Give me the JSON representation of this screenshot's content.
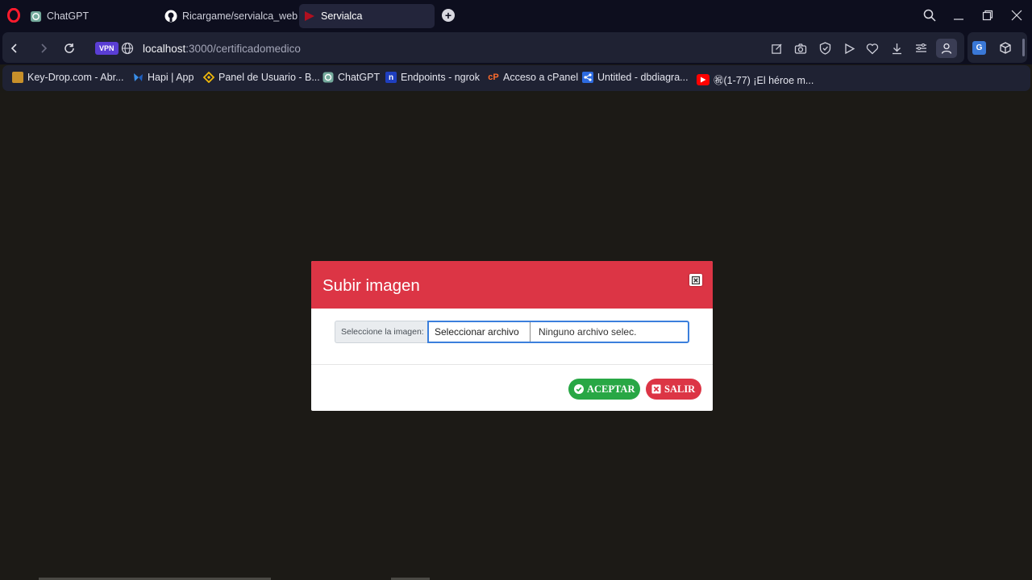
{
  "browser": {
    "tabs": [
      {
        "label": "ChatGPT",
        "icon": "chatgpt-icon"
      },
      {
        "label": "Ricargame/servialca_web",
        "icon": "github-icon"
      },
      {
        "label": "Servialca",
        "icon": "servialca-icon",
        "active": true
      }
    ],
    "vpn_label": "VPN",
    "url_host": "localhost",
    "url_path": ":3000/certificadomedico",
    "bookmarks": [
      {
        "label": "Key-Drop.com - Abr...",
        "icon": "keydrop-icon"
      },
      {
        "label": "Hapi | App",
        "icon": "hapi-icon"
      },
      {
        "label": "Panel de Usuario - B...",
        "icon": "binance-icon"
      },
      {
        "label": "ChatGPT",
        "icon": "chatgpt-icon"
      },
      {
        "label": "Endpoints - ngrok",
        "icon": "ngrok-icon"
      },
      {
        "label": "Acceso a cPanel",
        "icon": "cpanel-icon"
      },
      {
        "label": "Untitled - dbdiagra...",
        "icon": "dbdiagram-icon"
      },
      {
        "label": "㊗(1-77) ¡El héroe m...",
        "icon": "youtube-icon"
      }
    ],
    "translate_label": "G",
    "colors": {
      "chrome_bg": "#0d0e1e",
      "panel_bg": "#1f2233",
      "vpn": "#5a3ed4"
    }
  },
  "modal": {
    "title": "Subir imagen",
    "input_label": "Seleccione la imagen:",
    "file_button": "Seleccionar archivo",
    "file_status": "Ninguno archivo selec.",
    "accept_label": "ACEPTAR",
    "exit_label": "SALIR",
    "colors": {
      "header": "#dc3545",
      "accept": "#28a745",
      "exit": "#dc3545",
      "input_focus": "#3b7fdc"
    }
  }
}
